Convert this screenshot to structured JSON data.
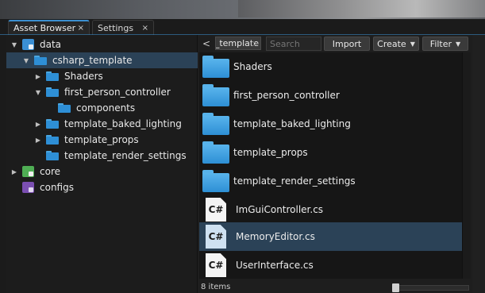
{
  "tabs": [
    {
      "label": "Asset Browser",
      "close": "×",
      "active": true
    },
    {
      "label": "Settings",
      "close": "×",
      "active": false
    }
  ],
  "tree": {
    "items": [
      {
        "label": "data",
        "icon": "data-package-icon",
        "expanded": true
      },
      {
        "label": "csharp_template",
        "icon": "folder-icon",
        "expanded": true,
        "selected": true
      },
      {
        "label": "Shaders",
        "icon": "folder-icon",
        "expanded": false
      },
      {
        "label": "first_person_controller",
        "icon": "folder-icon",
        "expanded": true
      },
      {
        "label": "components",
        "icon": "folder-icon"
      },
      {
        "label": "template_baked_lighting",
        "icon": "folder-icon",
        "expanded": false
      },
      {
        "label": "template_props",
        "icon": "folder-icon",
        "expanded": false
      },
      {
        "label": "template_render_settings",
        "icon": "folder-icon"
      },
      {
        "label": "core",
        "icon": "core-package-icon",
        "expanded": false
      },
      {
        "label": "configs",
        "icon": "configs-package-icon"
      }
    ]
  },
  "toolbar": {
    "back": "<",
    "forward": ">",
    "path": "csharp_template",
    "search_placeholder": "Search",
    "import_label": "Import",
    "create_label": "Create",
    "filter_label": "Filter"
  },
  "files": [
    {
      "label": "Shaders",
      "type": "folder"
    },
    {
      "label": "first_person_controller",
      "type": "folder"
    },
    {
      "label": "template_baked_lighting",
      "type": "folder"
    },
    {
      "label": "template_props",
      "type": "folder"
    },
    {
      "label": "template_render_settings",
      "type": "folder"
    },
    {
      "label": "ImGuiController.cs",
      "type": "cs",
      "icon_text": "C#"
    },
    {
      "label": "MemoryEditor.cs",
      "type": "cs",
      "icon_text": "C#",
      "selected": true
    },
    {
      "label": "UserInterface.cs",
      "type": "cs",
      "icon_text": "C#"
    }
  ],
  "status": {
    "item_count": "8 items"
  },
  "colors": {
    "accent": "#3b8fd0",
    "selection": "#2b4257",
    "folder": "#2e8fd6"
  }
}
